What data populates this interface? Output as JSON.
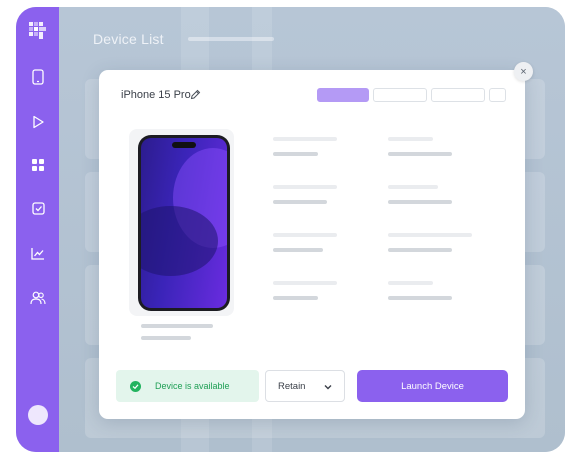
{
  "app": {
    "title": "Device List"
  },
  "sidebar": {
    "items": [
      {
        "icon": "smartphone-icon"
      },
      {
        "icon": "play-icon"
      },
      {
        "icon": "grid-icon"
      },
      {
        "icon": "checkbox-icon"
      },
      {
        "icon": "chart-icon"
      },
      {
        "icon": "users-icon"
      }
    ]
  },
  "modal": {
    "device_name": "iPhone 15 Pro",
    "close_label": "×",
    "status_text": "Device is available",
    "select_value": "Retain",
    "launch_label": "Launch Device"
  },
  "colors": {
    "accent": "#8b61ee",
    "available": "#22b35f"
  }
}
